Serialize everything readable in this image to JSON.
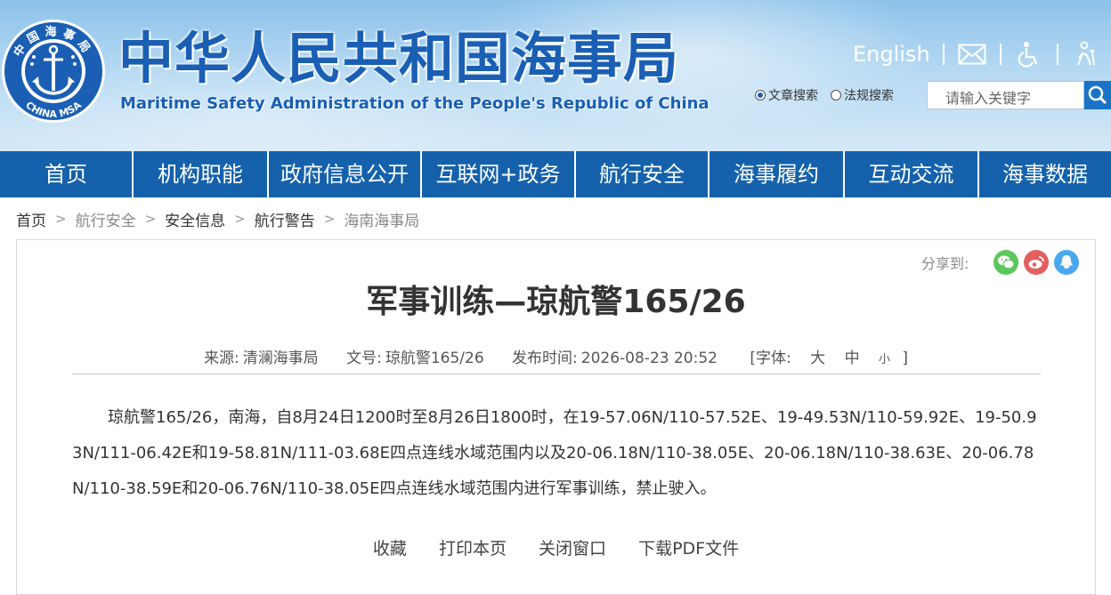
{
  "header": {
    "title_cn": "中华人民共和国海事局",
    "title_en": "Maritime Safety Administration of the People's Republic of China",
    "emblem_top_text": "中国海事局",
    "emblem_bottom_text": "CHINA MSA",
    "lang_link": "English",
    "icons": [
      "mail-icon",
      "accessibility-icon",
      "elderly-mode-icon"
    ],
    "search_options": [
      {
        "label": "文章搜索",
        "selected": true
      },
      {
        "label": "法规搜索",
        "selected": false
      }
    ],
    "search_placeholder": "请输入关键字",
    "colors": {
      "brand": "#1a5fb4",
      "nav": "#1561ab"
    }
  },
  "nav": {
    "items": [
      "首页",
      "机构职能",
      "政府信息公开",
      "互联网+政务",
      "航行安全",
      "海事履约",
      "互动交流",
      "海事数据"
    ]
  },
  "breadcrumb": [
    "首页",
    "航行安全",
    "安全信息",
    "航行警告",
    "海南海事局"
  ],
  "article": {
    "share_label": "分享到:",
    "share_icons": [
      "wechat-icon",
      "weibo-icon",
      "qq-icon"
    ],
    "title": "军事训练—琼航警165/26",
    "source_label": "来源:",
    "source": "清澜海事局",
    "docno_label": "文号:",
    "docno": "琼航警165/26",
    "time_label": "发布时间:",
    "time": "2026-08-23 20:52",
    "font_label": "[字体:",
    "font_large": "大",
    "font_medium": "中",
    "font_small": "小",
    "font_close": "]",
    "body": "琼航警165/26，南海，自8月24日1200时至8月26日1800时，在19-57.06N/110-57.52E、19-49.53N/110-59.92E、19-50.93N/111-06.42E和19-58.81N/111-03.68E四点连线水域范围内以及20-06.18N/110-38.05E、20-06.18N/110-38.63E、20-06.78N/110-38.59E和20-06.76N/110-38.05E四点连线水域范围内进行军事训练，禁止驶入。",
    "actions": [
      "收藏",
      "打印本页",
      "关闭窗口",
      "下载PDF文件"
    ]
  }
}
